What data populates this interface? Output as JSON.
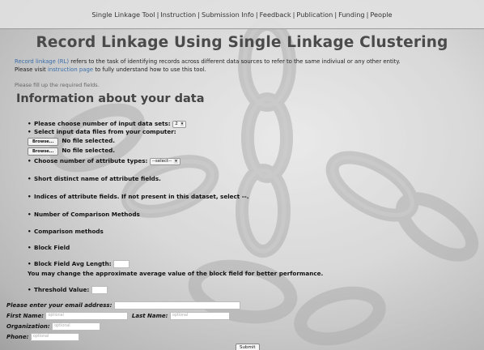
{
  "nav": {
    "items": [
      "Single Linkage Tool",
      "Instruction",
      "Submission Info",
      "Feedback",
      "Publication",
      "Funding",
      "People"
    ],
    "separator": "|"
  },
  "page": {
    "title": "Record Linkage Using Single Linkage Clustering",
    "intro_link": "Record linkage (RL)",
    "intro_text": " refers to the task of identifying records across different data sources to refer to the same indiviual or any other entity.",
    "intro_line2_pre": "Please visit ",
    "intro_line2_link": "instruction page",
    "intro_line2_post": " to fully understand how to use this tool.",
    "fill_note": "Please fill up the required fields.",
    "section_title": "Information about your data"
  },
  "form": {
    "num_datasets_label": "Please choose number of input data sets:",
    "num_datasets_value": "2",
    "select_files_label": "Select input data files from your computer:",
    "files": [
      {
        "button": "Browse...",
        "status": "No file selected."
      },
      {
        "button": "Browse...",
        "status": "No file selected."
      }
    ],
    "attr_types_label": "Choose number of attribute types:",
    "attr_types_value": "--select--",
    "short_name_label": "Short distinct name of attribute fields.",
    "indices_label": "Indices of attribute fields. If not present in this dataset, select --.",
    "num_comparison_label": "Number of Comparison Methods",
    "comparison_methods_label": "Comparison methods",
    "block_field_label": "Block Field",
    "block_avg_label": "Block Field Avg Length:",
    "block_avg_note": "You may change the approximate average value of the block field for better performance.",
    "threshold_label": "Threshold Value:"
  },
  "contact": {
    "email_label": "Please enter your email address:",
    "first_name_label": "First Name:",
    "first_name_placeholder": "optional",
    "last_name_label": "Last Name:",
    "last_name_placeholder": "optional",
    "organization_label": "Organization:",
    "organization_placeholder": "optional",
    "phone_label": "Phone:",
    "phone_placeholder": "optional",
    "submit_label": "Submit"
  },
  "colors": {
    "link": "#3a6ea8",
    "title": "#4a4a4a"
  }
}
